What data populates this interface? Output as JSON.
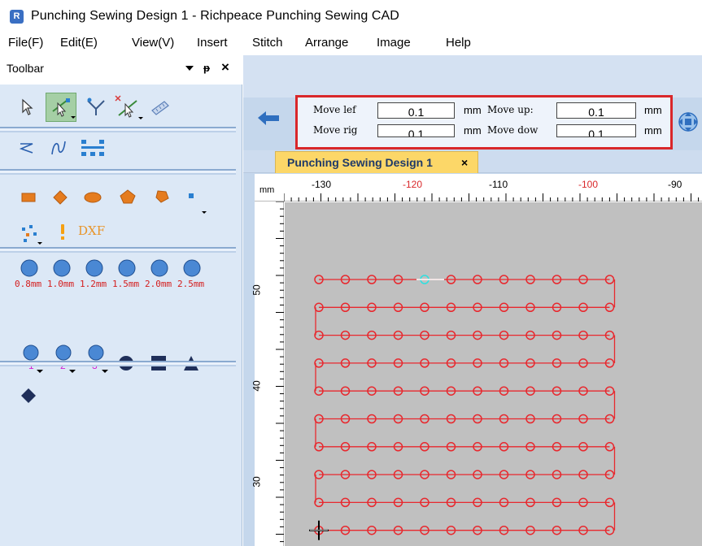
{
  "window": {
    "title": "Punching Sewing Design 1 - Richpeace Punching Sewing CAD",
    "icon": "app-logo-icon"
  },
  "menubar": {
    "items": [
      "File(F)",
      "Edit(E)",
      "View(V)",
      "Insert",
      "Stitch",
      "Arrange",
      "Image",
      "Help"
    ]
  },
  "toolbar": {
    "title": "Toolbar",
    "dropdown_glyph": "▼",
    "pin_glyph": "ᵽ",
    "close_glyph": "×",
    "punch_sizes": [
      "0.8mm",
      "1.0mm",
      "1.2mm",
      "1.5mm",
      "2.0mm",
      "2.5mm"
    ],
    "numbered_tools": [
      "1",
      "2",
      "3"
    ],
    "dxf_label": "DXF"
  },
  "nudge": {
    "move_left_label": "Move lef",
    "move_left_value": "0.1",
    "move_right_label": "Move rig",
    "move_right_value": "0.1",
    "move_up_label": "Move up:",
    "move_up_value": "0.1",
    "move_down_label": "Move dow",
    "move_down_value": "0.1",
    "unit": "mm"
  },
  "document_tab": {
    "label": "Punching Sewing Design 1",
    "close_glyph": "×"
  },
  "ruler": {
    "unit_label": "mm",
    "h_ticks": [
      "-130",
      "-120",
      "-110",
      "-100",
      "-90"
    ],
    "h_tick_colors": [
      "#000000",
      "#d9272a",
      "#000000",
      "#d9272a",
      "#000000"
    ],
    "v_ticks": [
      "50",
      "40",
      "30"
    ]
  },
  "colors": {
    "stitch": "#e8282e",
    "selected_stitch": "#2ee0e0",
    "highlight_box": "#d9272a",
    "tab_active": "#fcd768",
    "canvas": "#c0c0c0"
  },
  "design": {
    "rows": 10,
    "columns": 12,
    "selected_point": {
      "row": 0,
      "column": 4
    }
  }
}
